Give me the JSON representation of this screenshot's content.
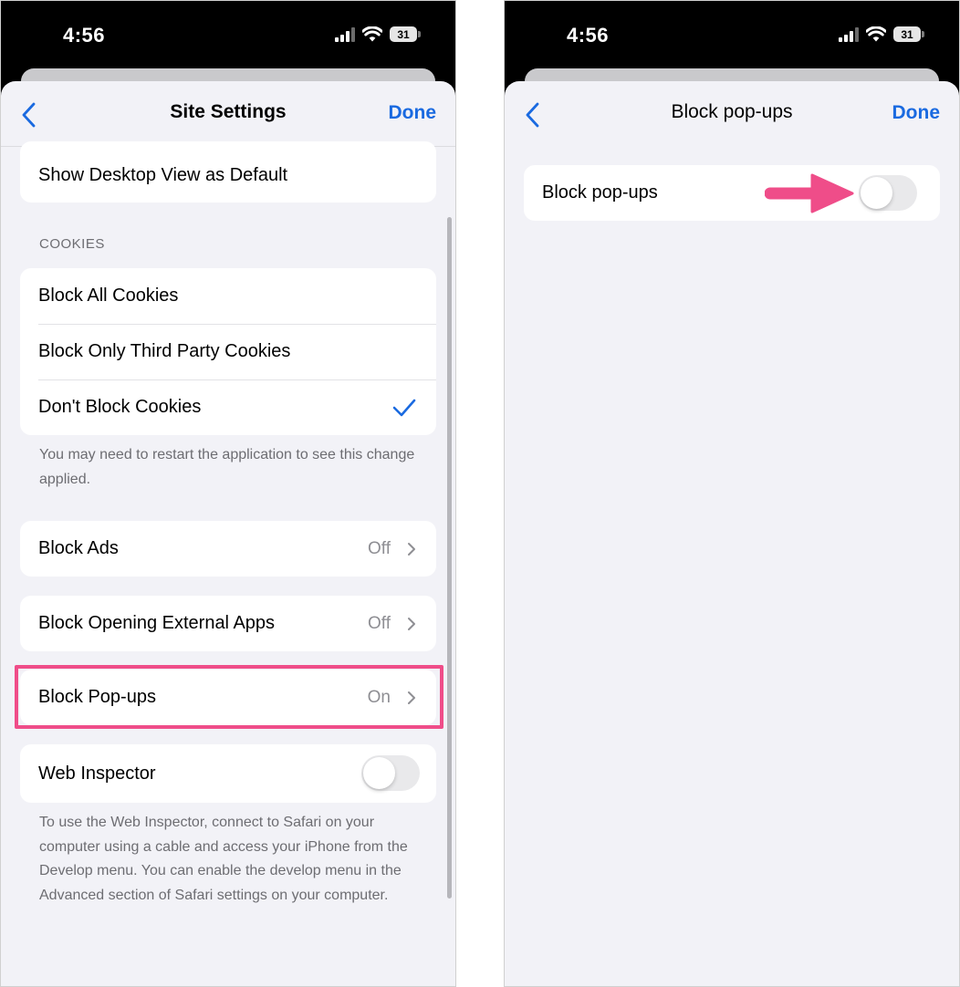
{
  "status_bar": {
    "time": "4:56",
    "battery": "31"
  },
  "left_screen": {
    "nav": {
      "title": "Site Settings",
      "done_label": "Done"
    },
    "top_row": {
      "label": "Show Desktop View as Default"
    },
    "cookies": {
      "header": "COOKIES",
      "options": [
        {
          "label": "Block All Cookies",
          "selected": false
        },
        {
          "label": "Block Only Third Party Cookies",
          "selected": false
        },
        {
          "label": "Don't Block Cookies",
          "selected": true
        }
      ],
      "footer": "You may need to restart the application to see this change applied."
    },
    "block_ads": {
      "label": "Block Ads",
      "value": "Off"
    },
    "block_external_apps": {
      "label": "Block Opening External Apps",
      "value": "Off"
    },
    "block_popups": {
      "label": "Block Pop-ups",
      "value": "On"
    },
    "web_inspector": {
      "label": "Web Inspector",
      "enabled": false,
      "footer": "To use the Web Inspector, connect to Safari on your computer using a cable and access your iPhone from the Develop menu. You can enable the develop menu in the Advanced section of Safari settings on your computer."
    }
  },
  "right_screen": {
    "nav": {
      "title": "Block pop-ups",
      "done_label": "Done"
    },
    "toggle_row": {
      "label": "Block pop-ups",
      "enabled": false
    }
  },
  "colors": {
    "accent": "#1a6ae0",
    "highlight": "#ef4d89",
    "grouped_background": "#f2f2f7",
    "secondary_text": "#6d6d72"
  },
  "icons": {
    "back": "chevron-left-icon",
    "disclosure": "chevron-right-icon",
    "checkmark": "checkmark-icon",
    "wifi": "wifi-icon",
    "signal": "cellular-signal-icon",
    "battery": "battery-icon",
    "annotation": "arrow-right-icon"
  }
}
